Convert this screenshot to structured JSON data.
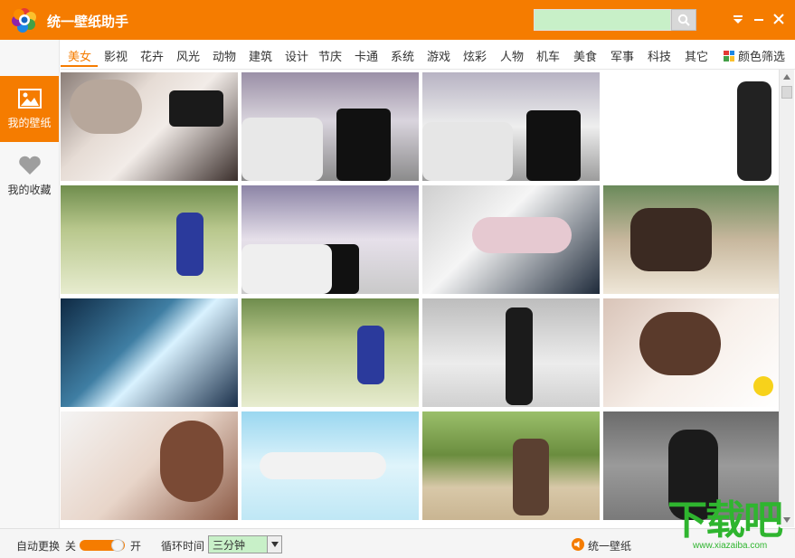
{
  "app": {
    "title": "统一壁纸助手"
  },
  "search": {
    "value": "",
    "placeholder": ""
  },
  "categories": [
    "美女",
    "影视",
    "花卉",
    "风光",
    "动物",
    "建筑",
    "设计",
    "节庆",
    "卡通",
    "系统",
    "游戏",
    "炫彩",
    "人物",
    "机车",
    "美食",
    "军事",
    "科技",
    "其它"
  ],
  "active_category": "美女",
  "color_filter_label": "颜色筛选",
  "sidebar": {
    "items": [
      {
        "label": "我的壁纸",
        "icon": "image-icon",
        "active": true
      },
      {
        "label": "我的收藏",
        "icon": "heart-icon",
        "active": false
      }
    ]
  },
  "bottom": {
    "auto_change_label": "自动更换",
    "off_label": "关",
    "on_label": "开",
    "cycle_label": "循环时间",
    "cycle_value": "三分钟",
    "brand_label": "统一壁纸"
  },
  "watermark": {
    "text": "下载吧",
    "url": "www.xiazaiba.com"
  },
  "colors": {
    "accent": "#f57c00",
    "search_bg": "#c8f0c8",
    "watermark": "#2fb52f"
  }
}
